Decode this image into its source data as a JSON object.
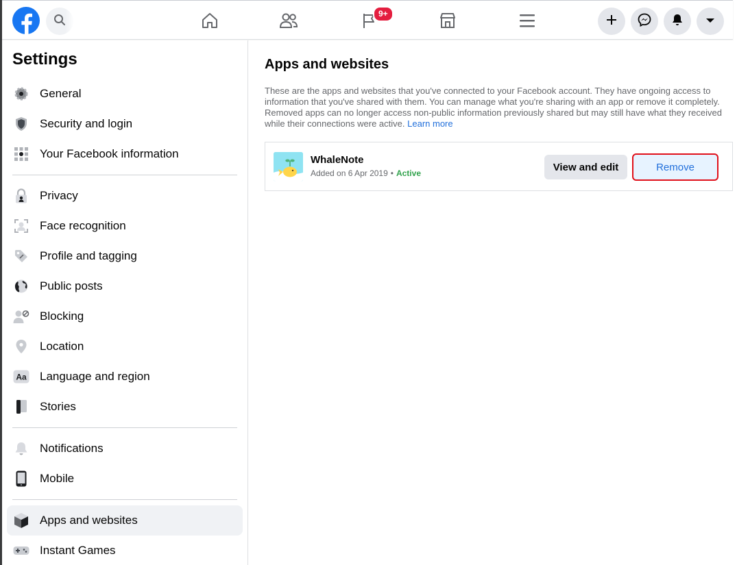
{
  "topbar": {
    "notifications_badge": "9+",
    "icons": [
      "facebook-logo",
      "search-icon",
      "home-icon",
      "friends-icon",
      "pages-flag-icon",
      "marketplace-icon",
      "menu-icon",
      "plus-icon",
      "messenger-icon",
      "notifications-bell-icon",
      "account-chevron-icon"
    ]
  },
  "sidebar": {
    "title": "Settings",
    "groups": [
      [
        {
          "label": "General",
          "icon": "gear-icon"
        },
        {
          "label": "Security and login",
          "icon": "shield-icon"
        },
        {
          "label": "Your Facebook information",
          "icon": "grid-icon"
        }
      ],
      [
        {
          "label": "Privacy",
          "icon": "lock-icon"
        },
        {
          "label": "Face recognition",
          "icon": "face-recognition-icon"
        },
        {
          "label": "Profile and tagging",
          "icon": "tag-icon"
        },
        {
          "label": "Public posts",
          "icon": "globe-icon"
        },
        {
          "label": "Blocking",
          "icon": "blocked-user-icon"
        },
        {
          "label": "Location",
          "icon": "location-pin-icon"
        },
        {
          "label": "Language and region",
          "icon": "language-icon"
        },
        {
          "label": "Stories",
          "icon": "book-icon"
        }
      ],
      [
        {
          "label": "Notifications",
          "icon": "bell-icon"
        },
        {
          "label": "Mobile",
          "icon": "phone-icon"
        }
      ],
      [
        {
          "label": "Apps and websites",
          "icon": "cube-icon",
          "active": true
        },
        {
          "label": "Instant Games",
          "icon": "gamepad-icon"
        }
      ]
    ]
  },
  "main": {
    "title": "Apps and websites",
    "description": "These are the apps and websites that you've connected to your Facebook account. They have ongoing access to information that you've shared with them. You can manage what you're sharing with an app or remove it completely. Removed apps can no longer access non-public information previously shared but may still have what they received while their connections were active.",
    "learn_more": "Learn more",
    "app": {
      "name": "WhaleNote",
      "added": "Added on 6 Apr 2019",
      "separator": "•",
      "status": "Active",
      "view_edit_label": "View and edit",
      "remove_label": "Remove"
    }
  },
  "colors": {
    "brand": "#1877f2",
    "active_status": "#31a24c",
    "badge": "#e41e3f",
    "highlight_border": "#e0101a"
  }
}
